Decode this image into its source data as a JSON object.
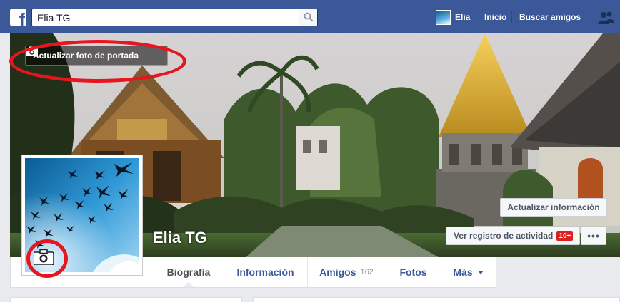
{
  "topbar": {
    "search_value": "Elia TG",
    "user_name": "Elia",
    "home_label": "Inicio",
    "find_friends_label": "Buscar amigos"
  },
  "cover": {
    "update_cover_label": "Actualizar foto de portada",
    "profile_name": "Elia TG",
    "update_info_label": "Actualizar información",
    "activity_log_label": "Ver registro de actividad",
    "activity_badge": "10+",
    "more_label": "•••"
  },
  "timeline": {
    "tabs": [
      {
        "label": "Biografía"
      },
      {
        "label": "Información"
      },
      {
        "label": "Amigos",
        "count": "162"
      },
      {
        "label": "Fotos"
      },
      {
        "label": "Más"
      }
    ]
  },
  "colors": {
    "brand": "#3b5998",
    "highlight_ring": "#e8141e",
    "badge": "#dc2121"
  }
}
